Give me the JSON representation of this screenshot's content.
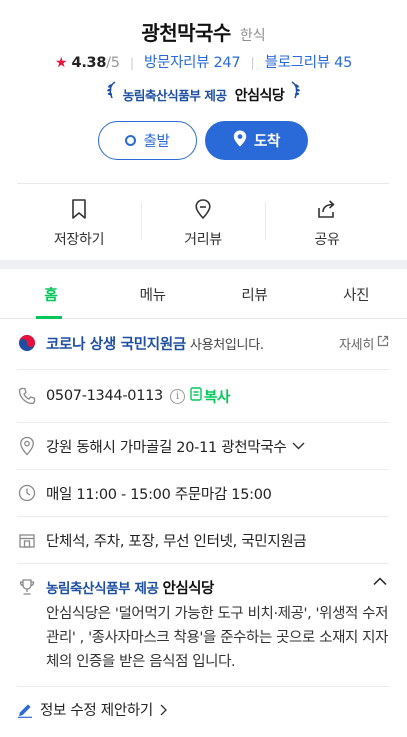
{
  "place": {
    "name": "광천막국수",
    "category": "한식",
    "rating": "4.38",
    "rating_max": "/5",
    "visitor_reviews": "방문자리뷰 247",
    "blog_reviews": "블로그리뷰 45",
    "badge_text": "농림축산식품부 제공",
    "badge_logo": "안심식당"
  },
  "buttons": {
    "start": "출발",
    "arrive": "도착"
  },
  "actions": [
    {
      "label": "저장하기",
      "icon": "bookmark-icon"
    },
    {
      "label": "거리뷰",
      "icon": "location-pin-icon"
    },
    {
      "label": "공유",
      "icon": "share-icon"
    }
  ],
  "tabs": [
    "홈",
    "메뉴",
    "리뷰",
    "사진"
  ],
  "info": {
    "covid_strong": "코로나 상생 국민지원금",
    "covid_rest": "사용처입니다.",
    "covid_more": "자세히",
    "phone": "0507-1344-0113",
    "copy_label": "복사",
    "address": "강원 동해시 가마골길 20-11 광천막국수",
    "hours": "매일 11:00 - 15:00 주문마감 15:00",
    "amenities": "단체석, 주차, 포장, 무선 인터넷, 국민지원금",
    "cert_title": "농림축산식품부 제공",
    "cert_logo": "안심식당",
    "cert_desc": "안심식당은 '덜어먹기 가능한 도구 비치·제공', '위생적 수저관리' , '종사자마스크 착용'을 준수하는 곳으로 소재지 지자체의 인증을 받은 음식점 입니다.",
    "suggest": "정보 수정 제안하기"
  },
  "colors": {
    "accent": "#2a6ad8",
    "green": "#03c75a",
    "star": "#e8113c",
    "navy": "#1d4ea1"
  }
}
